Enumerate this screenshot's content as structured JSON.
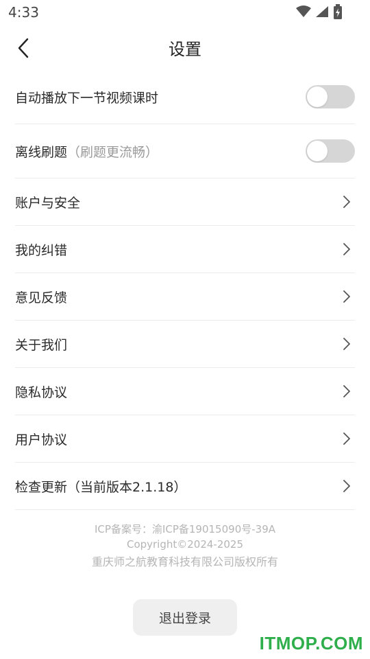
{
  "status_bar": {
    "time": "4:33",
    "icons": [
      "wifi-icon",
      "signal-icon",
      "battery-charging-icon"
    ]
  },
  "header": {
    "title": "设置",
    "back_icon": "chevron-left-icon"
  },
  "settings": {
    "autoplay": {
      "label": "自动播放下一节视频课时",
      "enabled": false
    },
    "offline": {
      "label": "离线刷题",
      "hint": "（刷题更流畅）",
      "enabled": false
    },
    "items": [
      {
        "label": "账户与安全"
      },
      {
        "label": "我的纠错"
      },
      {
        "label": "意见反馈"
      },
      {
        "label": "关于我们"
      },
      {
        "label": "隐私协议"
      },
      {
        "label": "用户协议"
      },
      {
        "label": "检查更新（当前版本2.1.18）"
      }
    ]
  },
  "footer": {
    "icp": "ICP备案号：渝ICP备19015090号-39A",
    "copyright": "Copyright©2024-2025",
    "company": "重庆师之航教育科技有限公司版权所有"
  },
  "logout": {
    "label": "退出登录"
  },
  "watermark": {
    "text": "ITMOP.COM"
  },
  "colors": {
    "toggle_off": "#d6d6d6",
    "divider": "#ececec",
    "footer_text": "#b5b5b5",
    "watermark": "#2fae4c"
  }
}
